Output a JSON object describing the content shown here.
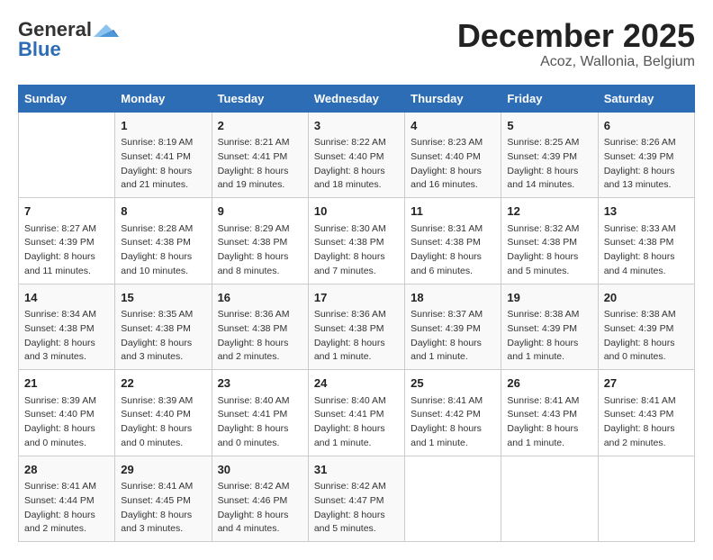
{
  "logo": {
    "general": "General",
    "blue": "Blue"
  },
  "title": "December 2025",
  "subtitle": "Acoz, Wallonia, Belgium",
  "days_of_week": [
    "Sunday",
    "Monday",
    "Tuesday",
    "Wednesday",
    "Thursday",
    "Friday",
    "Saturday"
  ],
  "weeks": [
    [
      {
        "num": "",
        "sunrise": "",
        "sunset": "",
        "daylight": ""
      },
      {
        "num": "1",
        "sunrise": "Sunrise: 8:19 AM",
        "sunset": "Sunset: 4:41 PM",
        "daylight": "Daylight: 8 hours and 21 minutes."
      },
      {
        "num": "2",
        "sunrise": "Sunrise: 8:21 AM",
        "sunset": "Sunset: 4:41 PM",
        "daylight": "Daylight: 8 hours and 19 minutes."
      },
      {
        "num": "3",
        "sunrise": "Sunrise: 8:22 AM",
        "sunset": "Sunset: 4:40 PM",
        "daylight": "Daylight: 8 hours and 18 minutes."
      },
      {
        "num": "4",
        "sunrise": "Sunrise: 8:23 AM",
        "sunset": "Sunset: 4:40 PM",
        "daylight": "Daylight: 8 hours and 16 minutes."
      },
      {
        "num": "5",
        "sunrise": "Sunrise: 8:25 AM",
        "sunset": "Sunset: 4:39 PM",
        "daylight": "Daylight: 8 hours and 14 minutes."
      },
      {
        "num": "6",
        "sunrise": "Sunrise: 8:26 AM",
        "sunset": "Sunset: 4:39 PM",
        "daylight": "Daylight: 8 hours and 13 minutes."
      }
    ],
    [
      {
        "num": "7",
        "sunrise": "Sunrise: 8:27 AM",
        "sunset": "Sunset: 4:39 PM",
        "daylight": "Daylight: 8 hours and 11 minutes."
      },
      {
        "num": "8",
        "sunrise": "Sunrise: 8:28 AM",
        "sunset": "Sunset: 4:38 PM",
        "daylight": "Daylight: 8 hours and 10 minutes."
      },
      {
        "num": "9",
        "sunrise": "Sunrise: 8:29 AM",
        "sunset": "Sunset: 4:38 PM",
        "daylight": "Daylight: 8 hours and 8 minutes."
      },
      {
        "num": "10",
        "sunrise": "Sunrise: 8:30 AM",
        "sunset": "Sunset: 4:38 PM",
        "daylight": "Daylight: 8 hours and 7 minutes."
      },
      {
        "num": "11",
        "sunrise": "Sunrise: 8:31 AM",
        "sunset": "Sunset: 4:38 PM",
        "daylight": "Daylight: 8 hours and 6 minutes."
      },
      {
        "num": "12",
        "sunrise": "Sunrise: 8:32 AM",
        "sunset": "Sunset: 4:38 PM",
        "daylight": "Daylight: 8 hours and 5 minutes."
      },
      {
        "num": "13",
        "sunrise": "Sunrise: 8:33 AM",
        "sunset": "Sunset: 4:38 PM",
        "daylight": "Daylight: 8 hours and 4 minutes."
      }
    ],
    [
      {
        "num": "14",
        "sunrise": "Sunrise: 8:34 AM",
        "sunset": "Sunset: 4:38 PM",
        "daylight": "Daylight: 8 hours and 3 minutes."
      },
      {
        "num": "15",
        "sunrise": "Sunrise: 8:35 AM",
        "sunset": "Sunset: 4:38 PM",
        "daylight": "Daylight: 8 hours and 3 minutes."
      },
      {
        "num": "16",
        "sunrise": "Sunrise: 8:36 AM",
        "sunset": "Sunset: 4:38 PM",
        "daylight": "Daylight: 8 hours and 2 minutes."
      },
      {
        "num": "17",
        "sunrise": "Sunrise: 8:36 AM",
        "sunset": "Sunset: 4:38 PM",
        "daylight": "Daylight: 8 hours and 1 minute."
      },
      {
        "num": "18",
        "sunrise": "Sunrise: 8:37 AM",
        "sunset": "Sunset: 4:39 PM",
        "daylight": "Daylight: 8 hours and 1 minute."
      },
      {
        "num": "19",
        "sunrise": "Sunrise: 8:38 AM",
        "sunset": "Sunset: 4:39 PM",
        "daylight": "Daylight: 8 hours and 1 minute."
      },
      {
        "num": "20",
        "sunrise": "Sunrise: 8:38 AM",
        "sunset": "Sunset: 4:39 PM",
        "daylight": "Daylight: 8 hours and 0 minutes."
      }
    ],
    [
      {
        "num": "21",
        "sunrise": "Sunrise: 8:39 AM",
        "sunset": "Sunset: 4:40 PM",
        "daylight": "Daylight: 8 hours and 0 minutes."
      },
      {
        "num": "22",
        "sunrise": "Sunrise: 8:39 AM",
        "sunset": "Sunset: 4:40 PM",
        "daylight": "Daylight: 8 hours and 0 minutes."
      },
      {
        "num": "23",
        "sunrise": "Sunrise: 8:40 AM",
        "sunset": "Sunset: 4:41 PM",
        "daylight": "Daylight: 8 hours and 0 minutes."
      },
      {
        "num": "24",
        "sunrise": "Sunrise: 8:40 AM",
        "sunset": "Sunset: 4:41 PM",
        "daylight": "Daylight: 8 hours and 1 minute."
      },
      {
        "num": "25",
        "sunrise": "Sunrise: 8:41 AM",
        "sunset": "Sunset: 4:42 PM",
        "daylight": "Daylight: 8 hours and 1 minute."
      },
      {
        "num": "26",
        "sunrise": "Sunrise: 8:41 AM",
        "sunset": "Sunset: 4:43 PM",
        "daylight": "Daylight: 8 hours and 1 minute."
      },
      {
        "num": "27",
        "sunrise": "Sunrise: 8:41 AM",
        "sunset": "Sunset: 4:43 PM",
        "daylight": "Daylight: 8 hours and 2 minutes."
      }
    ],
    [
      {
        "num": "28",
        "sunrise": "Sunrise: 8:41 AM",
        "sunset": "Sunset: 4:44 PM",
        "daylight": "Daylight: 8 hours and 2 minutes."
      },
      {
        "num": "29",
        "sunrise": "Sunrise: 8:41 AM",
        "sunset": "Sunset: 4:45 PM",
        "daylight": "Daylight: 8 hours and 3 minutes."
      },
      {
        "num": "30",
        "sunrise": "Sunrise: 8:42 AM",
        "sunset": "Sunset: 4:46 PM",
        "daylight": "Daylight: 8 hours and 4 minutes."
      },
      {
        "num": "31",
        "sunrise": "Sunrise: 8:42 AM",
        "sunset": "Sunset: 4:47 PM",
        "daylight": "Daylight: 8 hours and 5 minutes."
      },
      {
        "num": "",
        "sunrise": "",
        "sunset": "",
        "daylight": ""
      },
      {
        "num": "",
        "sunrise": "",
        "sunset": "",
        "daylight": ""
      },
      {
        "num": "",
        "sunrise": "",
        "sunset": "",
        "daylight": ""
      }
    ]
  ]
}
